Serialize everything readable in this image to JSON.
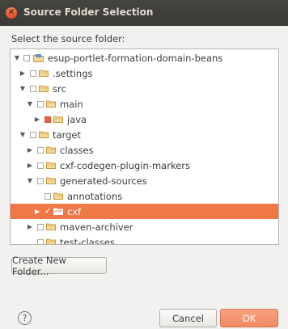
{
  "window": {
    "title": "Source Folder Selection"
  },
  "prompt": "Select the source folder:",
  "tree": [
    {
      "label": "esup-portlet-formation-domain-beans",
      "arrow": "▼",
      "check": "empty",
      "icon": "project"
    },
    {
      "label": ".settings",
      "arrow": "▶",
      "check": "empty",
      "icon": "folder"
    },
    {
      "label": "src",
      "arrow": "▼",
      "check": "empty",
      "icon": "folder"
    },
    {
      "label": "main",
      "arrow": "▼",
      "check": "empty",
      "icon": "folder"
    },
    {
      "label": "java",
      "arrow": "▶",
      "check": "filled",
      "icon": "folder"
    },
    {
      "label": "target",
      "arrow": "▼",
      "check": "empty",
      "icon": "folder"
    },
    {
      "label": "classes",
      "arrow": "▶",
      "check": "empty",
      "icon": "folder"
    },
    {
      "label": "cxf-codegen-plugin-markers",
      "arrow": "▶",
      "check": "empty",
      "icon": "folder"
    },
    {
      "label": "generated-sources",
      "arrow": "▼",
      "check": "empty",
      "icon": "folder"
    },
    {
      "label": "annotations",
      "arrow": "",
      "check": "empty",
      "icon": "folder"
    },
    {
      "label": "cxf",
      "arrow": "▶",
      "check": "checked",
      "icon": "folder",
      "selected": true
    },
    {
      "label": "maven-archiver",
      "arrow": "▶",
      "check": "empty",
      "icon": "folder"
    },
    {
      "label": "test-classes",
      "arrow": "",
      "check": "empty",
      "icon": "folder"
    }
  ],
  "buttons": {
    "create_folder": "Create New Folder...",
    "cancel": "Cancel",
    "ok": "OK",
    "help": "?"
  },
  "colors": {
    "selection": "#f07746",
    "titlebar": "#3b3a36",
    "ok_button": "#f08a62"
  }
}
